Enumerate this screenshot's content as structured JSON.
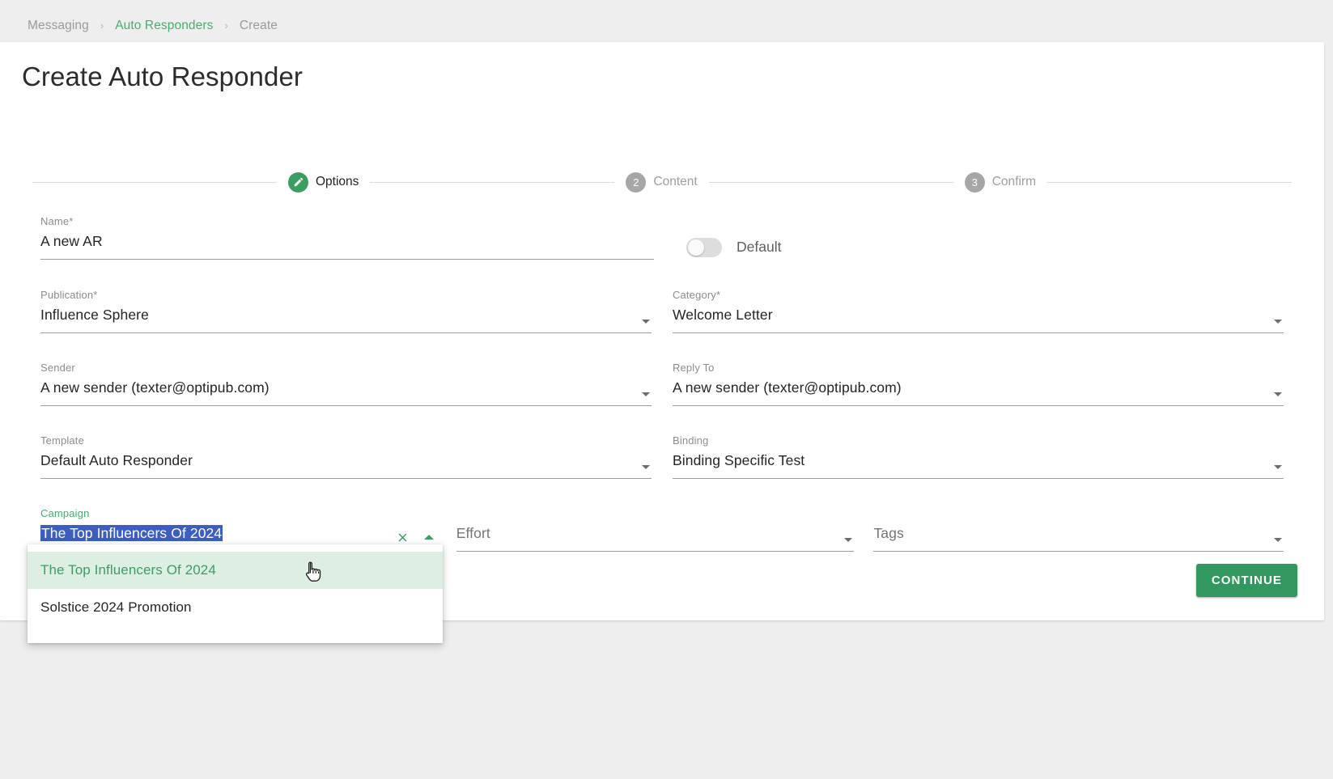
{
  "breadcrumb": {
    "items": [
      {
        "label": "Messaging",
        "type": "muted"
      },
      {
        "label": "Auto Responders",
        "type": "link"
      },
      {
        "label": "Create",
        "type": "muted"
      }
    ],
    "separator": "›"
  },
  "page": {
    "title": "Create Auto Responder"
  },
  "stepper": {
    "steps": [
      {
        "number": "",
        "label": "Options",
        "state": "active",
        "icon": "pencil-icon"
      },
      {
        "number": "2",
        "label": "Content",
        "state": "inactive"
      },
      {
        "number": "3",
        "label": "Confirm",
        "state": "inactive"
      }
    ]
  },
  "form": {
    "name": {
      "label": "Name*",
      "value": "A new AR"
    },
    "default_toggle": {
      "label": "Default",
      "state": "off"
    },
    "publication": {
      "label": "Publication*",
      "value": "Influence Sphere"
    },
    "category": {
      "label": "Category*",
      "value": "Welcome Letter"
    },
    "sender": {
      "label": "Sender",
      "value": "A new sender (texter@optipub.com)"
    },
    "reply_to": {
      "label": "Reply To",
      "value": "A new sender (texter@optipub.com)"
    },
    "template": {
      "label": "Template",
      "value": "Default Auto Responder"
    },
    "binding": {
      "label": "Binding",
      "value": "Binding Specific Test"
    },
    "campaign": {
      "label": "Campaign",
      "value": "The Top Influencers Of 2024",
      "selected_text": true,
      "clear_icon": "close-icon",
      "toggle_icon": "caret-up-icon"
    },
    "effort": {
      "label": "Effort",
      "value": "",
      "placeholder": "Effort"
    },
    "tags": {
      "label": "Tags",
      "value": "",
      "placeholder": "Tags"
    }
  },
  "campaign_dropdown": {
    "open": true,
    "options": [
      {
        "label": "The Top Influencers Of 2024",
        "selected": true
      },
      {
        "label": "Solstice 2024 Promotion",
        "selected": false
      }
    ]
  },
  "footer": {
    "continue_label": "CONTINUE"
  },
  "colors": {
    "accent_green": "#3a9e63",
    "link_green": "#46ad6e",
    "selection_blue": "#3b5ec0",
    "option_highlight": "#dcefe2",
    "page_background": "#eeeeee"
  }
}
